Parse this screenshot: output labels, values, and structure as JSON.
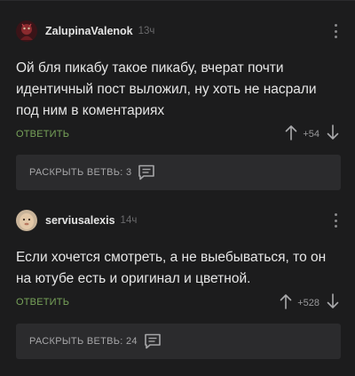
{
  "comments": [
    {
      "username": "ZalupinaValenok",
      "time": "13ч",
      "text": "Ой бля пикабу такое пикабу, вчерат почти идентичный пост выложил, ну хоть не насрали под ним в коментариях",
      "reply_label": "ОТВЕТИТЬ",
      "rating": "+54",
      "branch_label": "РАСКРЫТЬ ВЕТВЬ: 3"
    },
    {
      "username": "serviusalexis",
      "time": "14ч",
      "text": "Если хочется смотреть, а не выебываться, то он на ютубе есть и оригинал и цветной.",
      "reply_label": "ОТВЕТИТЬ",
      "rating": "+528",
      "branch_label": "РАСКРЫТЬ ВЕТВЬ: 24"
    }
  ],
  "colors": {
    "background": "#1c1c1d",
    "reply_accent": "#78a35a",
    "branch_bg": "#2b2b2d"
  },
  "icons": [
    "avatar",
    "more-vert-icon",
    "arrow-up-icon",
    "arrow-down-icon",
    "comments-icon"
  ]
}
